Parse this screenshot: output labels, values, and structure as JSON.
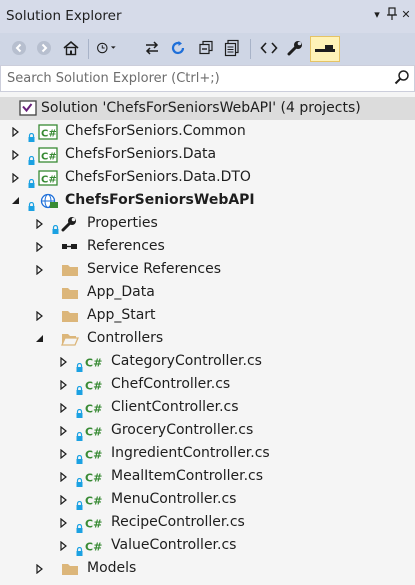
{
  "window": {
    "title": "Solution Explorer",
    "pin_glyph": "▾",
    "close_glyph": "✕"
  },
  "search": {
    "placeholder": "Search Solution Explorer (Ctrl+;)"
  },
  "solution": {
    "label": "Solution 'ChefsForSeniorsWebAPI' (4 projects)"
  },
  "projects": [
    {
      "label": "ChefsForSeniors.Common"
    },
    {
      "label": "ChefsForSeniors.Data"
    },
    {
      "label": "ChefsForSeniors.Data.DTO"
    },
    {
      "label": "ChefsForSeniorsWebAPI"
    }
  ],
  "webapi_children": [
    {
      "label": "Properties"
    },
    {
      "label": "References"
    },
    {
      "label": "Service References"
    },
    {
      "label": "App_Data"
    },
    {
      "label": "App_Start"
    },
    {
      "label": "Controllers"
    },
    {
      "label": "Models"
    }
  ],
  "controllers": [
    {
      "label": "CategoryController.cs"
    },
    {
      "label": "ChefController.cs"
    },
    {
      "label": "ClientController.cs"
    },
    {
      "label": "GroceryController.cs"
    },
    {
      "label": "IngredientController.cs"
    },
    {
      "label": "MealItemController.cs"
    },
    {
      "label": "MenuController.cs"
    },
    {
      "label": "RecipeController.cs"
    },
    {
      "label": "ValueController.cs"
    }
  ],
  "colors": {
    "folder": "#dcb67a",
    "csharp_green": "#388a34",
    "lock_blue": "#1ba1e2",
    "toolbar_blue": "#1e6fd9"
  },
  "icons": [
    "back-icon",
    "forward-icon",
    "home-icon",
    "history-icon",
    "sync-icon",
    "refresh-icon",
    "collapse-all-icon",
    "show-all-files-icon",
    "view-code-icon",
    "properties-wrench-icon",
    "preview-selected-icon",
    "search-icon"
  ]
}
